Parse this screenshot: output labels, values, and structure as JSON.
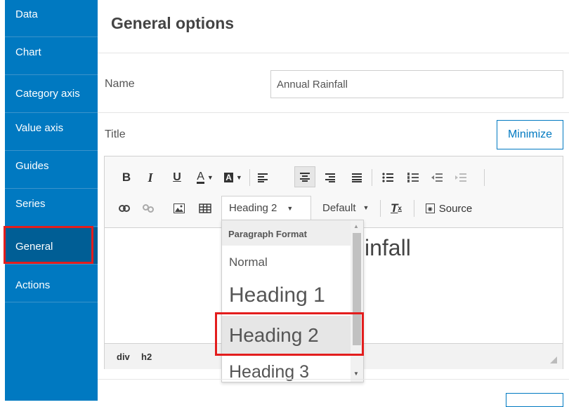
{
  "sidebar": {
    "items": [
      {
        "label": "Data"
      },
      {
        "label": "Chart"
      },
      {
        "label": "Category axis"
      },
      {
        "label": "Value axis"
      },
      {
        "label": "Guides"
      },
      {
        "label": "Series"
      },
      {
        "label": "General",
        "active": true
      },
      {
        "label": "Actions"
      }
    ]
  },
  "main": {
    "title": "General options",
    "name_label": "Name",
    "name_value": "Annual Rainfall",
    "title_label": "Title",
    "minimize_label": "Minimize"
  },
  "editor": {
    "toolbar": {
      "format_combo": "Heading 2",
      "font_combo": "Default",
      "source_label": "Source"
    },
    "content_visible_text": "infall",
    "path": [
      "div",
      "h2"
    ]
  },
  "dropdown": {
    "header": "Paragraph Format",
    "items": [
      "Normal",
      "Heading 1",
      "Heading 2",
      "Heading 3"
    ],
    "selected": "Heading 2"
  },
  "colors": {
    "sidebar_bg": "#0079c1",
    "sidebar_active": "#005e95",
    "highlight": "#e31d1d"
  }
}
